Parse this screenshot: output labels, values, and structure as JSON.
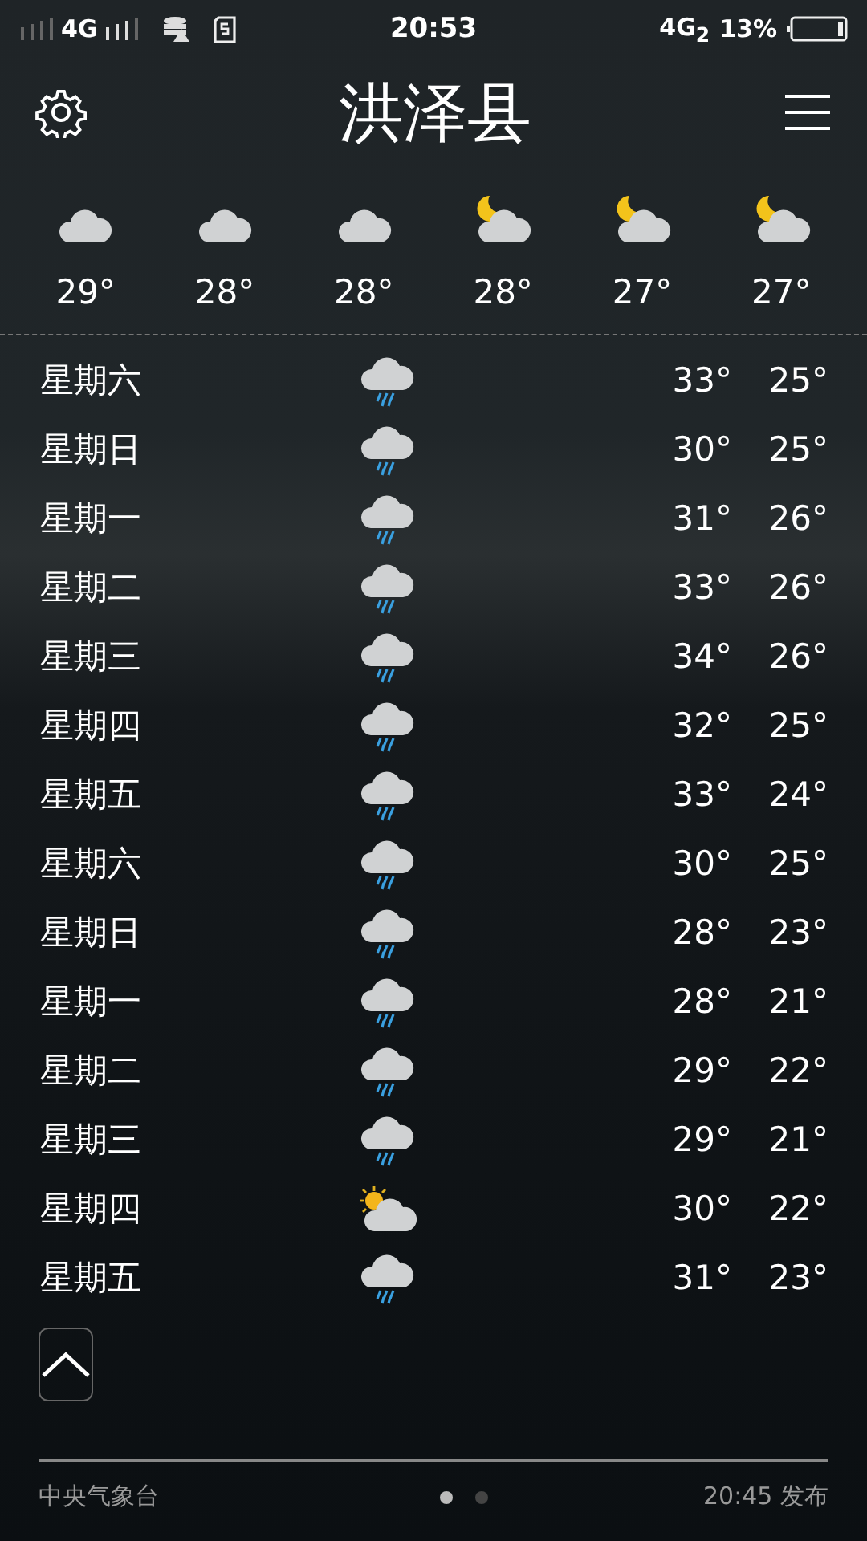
{
  "status_bar": {
    "network_left": "4G",
    "time": "20:53",
    "network_right": "4G$_{2}$",
    "battery": "13%"
  },
  "header": {
    "title": "洪泽县"
  },
  "hourly": [
    {
      "kind": "cloudy",
      "temp": "29°"
    },
    {
      "kind": "cloudy",
      "temp": "28°"
    },
    {
      "kind": "cloudy",
      "temp": "28°"
    },
    {
      "kind": "cloudy_night",
      "temp": "28°"
    },
    {
      "kind": "cloudy_night",
      "temp": "27°"
    },
    {
      "kind": "cloudy_night",
      "temp": "27°"
    }
  ],
  "daily": [
    {
      "day": "星期六",
      "kind": "rain",
      "high": "33°",
      "low": "25°"
    },
    {
      "day": "星期日",
      "kind": "rain",
      "high": "30°",
      "low": "25°"
    },
    {
      "day": "星期一",
      "kind": "rain",
      "high": "31°",
      "low": "26°"
    },
    {
      "day": "星期二",
      "kind": "rain",
      "high": "33°",
      "low": "26°"
    },
    {
      "day": "星期三",
      "kind": "rain",
      "high": "34°",
      "low": "26°"
    },
    {
      "day": "星期四",
      "kind": "rain",
      "high": "32°",
      "low": "25°"
    },
    {
      "day": "星期五",
      "kind": "rain",
      "high": "33°",
      "low": "24°"
    },
    {
      "day": "星期六",
      "kind": "rain",
      "high": "30°",
      "low": "25°"
    },
    {
      "day": "星期日",
      "kind": "rain",
      "high": "28°",
      "low": "23°"
    },
    {
      "day": "星期一",
      "kind": "rain",
      "high": "28°",
      "low": "21°"
    },
    {
      "day": "星期二",
      "kind": "rain",
      "high": "29°",
      "low": "22°"
    },
    {
      "day": "星期三",
      "kind": "rain",
      "high": "29°",
      "low": "21°"
    },
    {
      "day": "星期四",
      "kind": "sun_cloud",
      "high": "30°",
      "low": "22°"
    },
    {
      "day": "星期五",
      "kind": "rain",
      "high": "31°",
      "low": "23°"
    }
  ],
  "footer": {
    "source": "中央气象台",
    "pages": [
      {
        "selected": true
      },
      {
        "selected": false
      }
    ],
    "published": "20:45 发布"
  }
}
